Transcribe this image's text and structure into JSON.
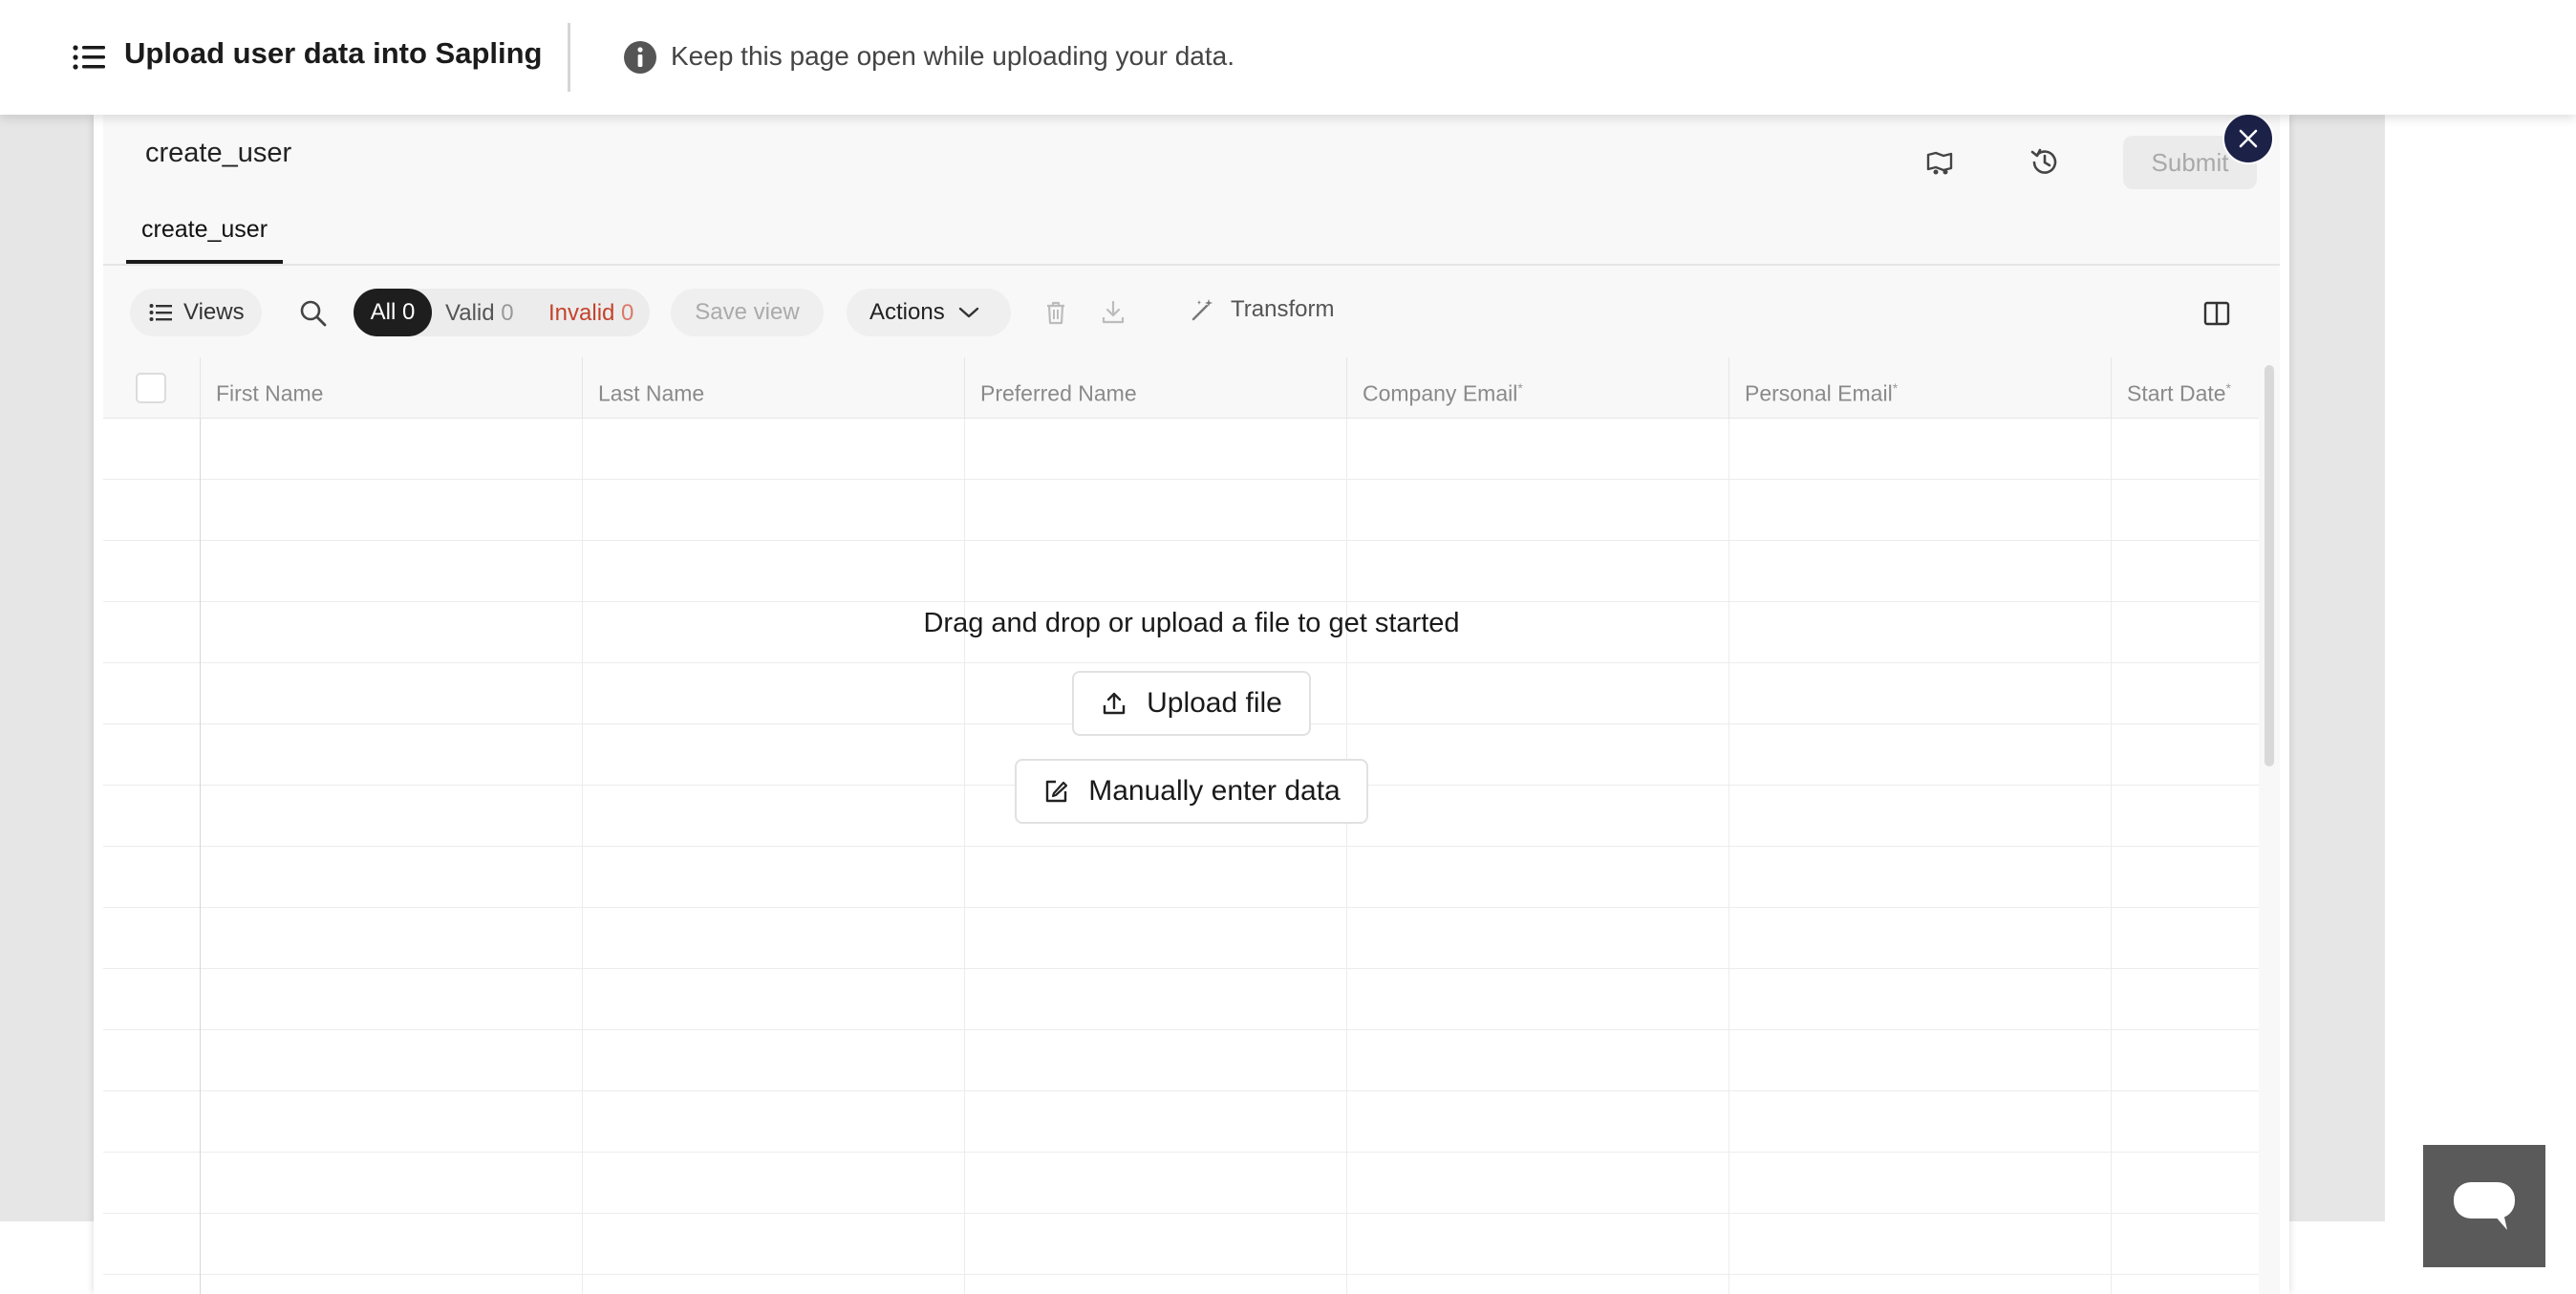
{
  "header": {
    "title": "Upload user data into Sapling",
    "info_text": "Keep this page open while uploading your data."
  },
  "modal": {
    "sheet_title": "create_user",
    "tab_label": "create_user",
    "submit_label": "Submit"
  },
  "toolbar": {
    "views_label": "Views",
    "filters": {
      "all_label": "All",
      "all_count": "0",
      "valid_label": "Valid",
      "valid_count": "0",
      "invalid_label": "Invalid",
      "invalid_count": "0"
    },
    "save_view_label": "Save view",
    "actions_label": "Actions",
    "transform_label": "Transform"
  },
  "table": {
    "columns": [
      {
        "label": "First Name",
        "required": ""
      },
      {
        "label": "Last Name",
        "required": ""
      },
      {
        "label": "Preferred Name",
        "required": ""
      },
      {
        "label": "Company Email",
        "required": "*"
      },
      {
        "label": "Personal Email",
        "required": "*"
      },
      {
        "label": "Start Date",
        "required": "*"
      }
    ]
  },
  "empty_state": {
    "message": "Drag and drop or upload a file to get started",
    "upload_label": "Upload file",
    "manual_label": "Manually enter data"
  },
  "colors": {
    "close_button": "#1c2148",
    "invalid": "#c4432b",
    "active_filter": "#1e1e1e"
  }
}
